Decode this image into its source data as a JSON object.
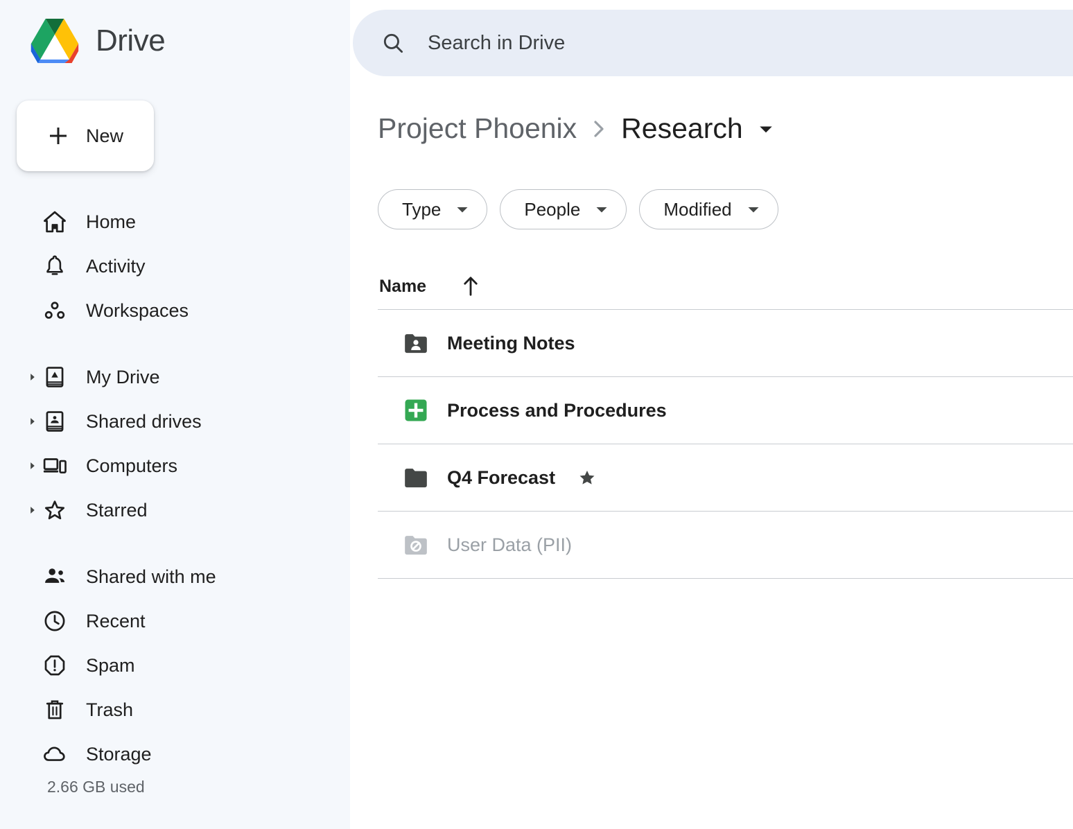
{
  "app": {
    "name": "Drive",
    "logo_colors": {
      "green": "#1da462",
      "green_dark": "#136e3a",
      "yellow": "#ffc107",
      "yellow_dark": "#e8a600",
      "blue": "#4c8bf5",
      "blue_dark": "#1a65d8",
      "red": "#e8412d"
    }
  },
  "search": {
    "placeholder": "Search in Drive",
    "icon": "search-icon"
  },
  "sidebar": {
    "new_button": {
      "label": "New",
      "icon": "plus-icon"
    },
    "primary_items": [
      {
        "label": "Home",
        "icon": "home-icon"
      },
      {
        "label": "Activity",
        "icon": "bell-icon"
      },
      {
        "label": "Workspaces",
        "icon": "workspaces-icon"
      }
    ],
    "tree_items": [
      {
        "label": "My Drive",
        "icon": "my-drive-icon",
        "caret": "chevron-right-icon",
        "expanded": false
      },
      {
        "label": "Shared drives",
        "icon": "shared-drives-icon",
        "caret": "chevron-right-icon",
        "expanded": false
      },
      {
        "label": "Computers",
        "icon": "computers-icon",
        "caret": "chevron-right-icon",
        "expanded": false
      },
      {
        "label": "Starred",
        "icon": "star-outline-icon",
        "caret": "chevron-right-icon",
        "expanded": false
      }
    ],
    "secondary_items": [
      {
        "label": "Shared with me",
        "icon": "people-icon"
      },
      {
        "label": "Recent",
        "icon": "clock-icon"
      },
      {
        "label": "Spam",
        "icon": "spam-icon"
      },
      {
        "label": "Trash",
        "icon": "trash-icon"
      },
      {
        "label": "Storage",
        "icon": "cloud-icon"
      }
    ],
    "storage_used": "2.66 GB used"
  },
  "main": {
    "breadcrumb": {
      "parent": "Project Phoenix",
      "separator": "chevron-right-icon",
      "current": "Research",
      "caret": "caret-down-icon"
    },
    "filters": [
      {
        "label": "Type",
        "caret": "caret-down-icon"
      },
      {
        "label": "People",
        "caret": "caret-down-icon"
      },
      {
        "label": "Modified",
        "caret": "caret-down-icon"
      }
    ],
    "table": {
      "columns": [
        {
          "label": "Name",
          "sort": "ascending",
          "sort_icon": "arrow-up-icon"
        }
      ],
      "rows": [
        {
          "name": "Meeting Notes",
          "icon": "shared-folder-icon",
          "icon_color": "#444746",
          "starred": false,
          "disabled": false
        },
        {
          "name": "Process and Procedures",
          "icon": "google-sheets-icon",
          "icon_color": "#34a853",
          "starred": false,
          "disabled": false
        },
        {
          "name": "Q4 Forecast",
          "icon": "folder-icon",
          "icon_color": "#444746",
          "starred": true,
          "star_icon": "star-filled-icon",
          "disabled": false
        },
        {
          "name": "User Data (PII)",
          "icon": "restricted-folder-icon",
          "icon_color": "#bdc1c6",
          "starred": false,
          "disabled": true
        }
      ]
    }
  }
}
